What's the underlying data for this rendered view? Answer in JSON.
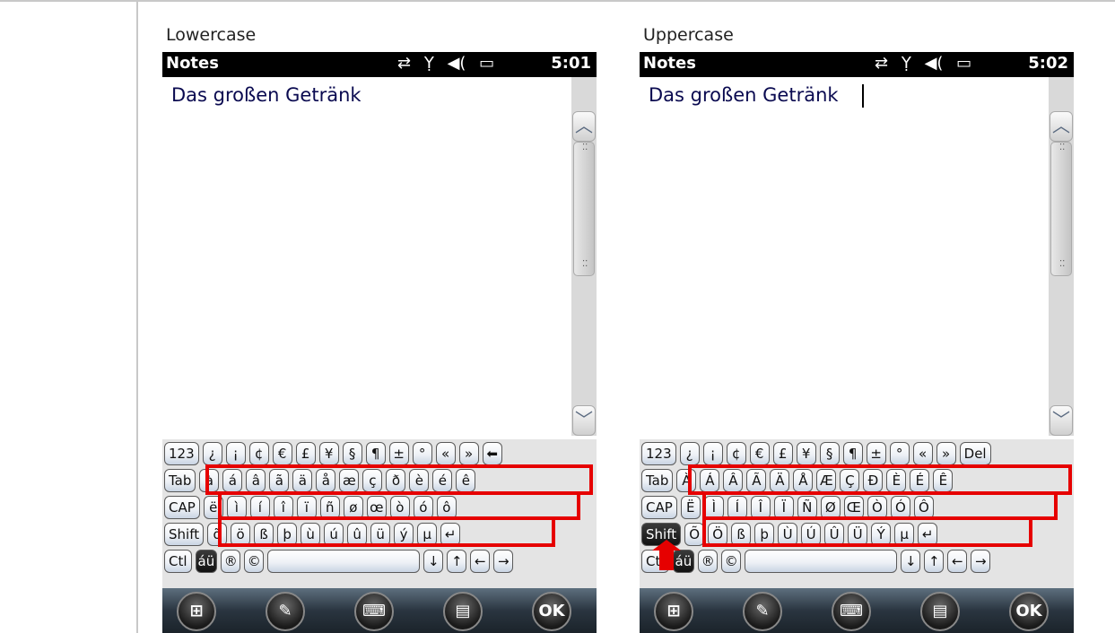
{
  "panels": [
    {
      "caption": "Lowercase",
      "status": {
        "title": "Notes",
        "icons": [
          "⇄",
          "Ỵ",
          "◀(",
          "▭"
        ],
        "time": "5:01"
      },
      "note_text": "Das großen Getränk",
      "keyboard": {
        "row1": [
          "123",
          "¿",
          "¡",
          "¢",
          "€",
          "£",
          "¥",
          "§",
          "¶",
          "±",
          "°",
          "«",
          "»",
          "⬅"
        ],
        "row2": [
          "Tab",
          "à",
          "á",
          "â",
          "ã",
          "ä",
          "å",
          "æ",
          "ç",
          "ð",
          "è",
          "é",
          "ê"
        ],
        "row3": [
          "CAP",
          "ë",
          "ì",
          "í",
          "î",
          "ï",
          "ñ",
          "ø",
          "œ",
          "ò",
          "ó",
          "ô"
        ],
        "row4": [
          "Shift",
          "õ",
          "ö",
          "ß",
          "þ",
          "ù",
          "ú",
          "û",
          "ü",
          "ý",
          "µ",
          "↵"
        ],
        "row5": [
          "Ctl",
          "áü",
          "®",
          "©",
          "",
          "↓",
          "↑",
          "←",
          "→"
        ]
      },
      "taskbar": [
        "⊞",
        "✎",
        "⌨",
        "▤",
        "OK"
      ]
    },
    {
      "caption": "Uppercase",
      "status": {
        "title": "Notes",
        "icons": [
          "⇄",
          "Ỵ",
          "◀(",
          "▭"
        ],
        "time": "5:02"
      },
      "note_text": "Das großen Getränk",
      "keyboard": {
        "row1": [
          "123",
          "¿",
          "¡",
          "¢",
          "€",
          "£",
          "¥",
          "§",
          "¶",
          "±",
          "°",
          "«",
          "»",
          "Del"
        ],
        "row2": [
          "Tab",
          "À",
          "Á",
          "Â",
          "Ã",
          "Ä",
          "Å",
          "Æ",
          "Ç",
          "Ð",
          "È",
          "É",
          "Ê"
        ],
        "row3": [
          "CAP",
          "Ë",
          "Ì",
          "Í",
          "Î",
          "Ï",
          "Ñ",
          "Ø",
          "Œ",
          "Ò",
          "Ó",
          "Ô"
        ],
        "row4": [
          "Shift",
          "Õ",
          "Ö",
          "ß",
          "þ",
          "Ù",
          "Ú",
          "Û",
          "Ü",
          "Ý",
          "µ",
          "↵"
        ],
        "row5": [
          "Ctl",
          "áü",
          "®",
          "©",
          "",
          "↓",
          "↑",
          "←",
          "→"
        ]
      },
      "taskbar": [
        "⊞",
        "✎",
        "⌨",
        "▤",
        "OK"
      ]
    }
  ],
  "colors": {
    "highlight": "#e60000",
    "statusbar": "#000000"
  }
}
